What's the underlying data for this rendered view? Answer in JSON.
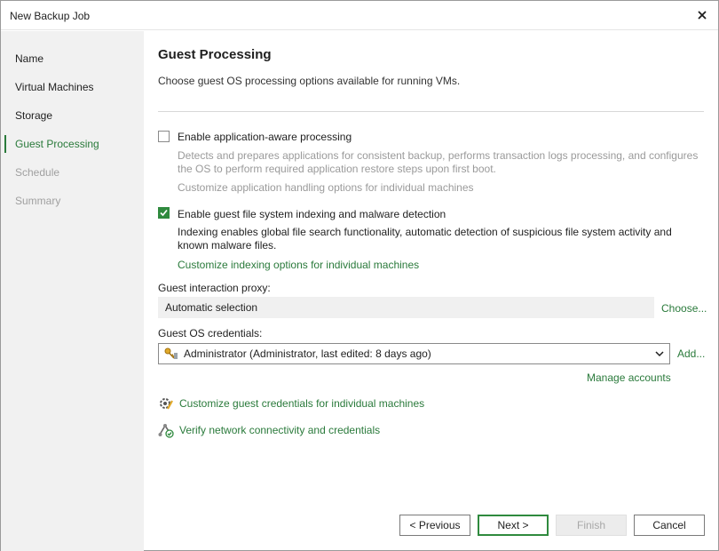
{
  "window": {
    "title": "New Backup Job"
  },
  "sidebar": {
    "steps": [
      {
        "label": "Name",
        "state": "normal"
      },
      {
        "label": "Virtual Machines",
        "state": "normal"
      },
      {
        "label": "Storage",
        "state": "normal"
      },
      {
        "label": "Guest Processing",
        "state": "active"
      },
      {
        "label": "Schedule",
        "state": "disabled"
      },
      {
        "label": "Summary",
        "state": "disabled"
      }
    ]
  },
  "page": {
    "title": "Guest Processing",
    "subtitle": "Choose guest OS processing options available for running VMs."
  },
  "app_aware": {
    "label": "Enable application-aware processing",
    "checked": false,
    "description_line1": "Detects and prepares applications for consistent backup, performs transaction logs processing, and configures",
    "description_line2": "the OS to perform required application restore steps upon first boot.",
    "link": "Customize application handling options for individual machines"
  },
  "indexing": {
    "label": "Enable guest file system indexing and malware detection",
    "checked": true,
    "description_line1": "Indexing enables global file search functionality, automatic detection of suspicious file system activity and",
    "description_line2": "known malware files.",
    "link": "Customize indexing options for individual machines"
  },
  "proxy": {
    "label": "Guest interaction proxy:",
    "value": "Automatic selection",
    "choose": "Choose..."
  },
  "credentials": {
    "label": "Guest OS credentials:",
    "value": "Administrator  (Administrator, last edited: 8 days ago)",
    "add": "Add...",
    "manage": "Manage accounts"
  },
  "actions": {
    "customize_credentials": "Customize guest credentials for individual machines",
    "verify": "Verify network connectivity and credentials"
  },
  "buttons": {
    "previous": "< Previous",
    "next": "Next >",
    "finish": "Finish",
    "cancel": "Cancel"
  },
  "colors": {
    "accent": "#2a7a3b",
    "checkbox": "#2f8a3e",
    "sidebar_bg": "#f1f1f1"
  }
}
